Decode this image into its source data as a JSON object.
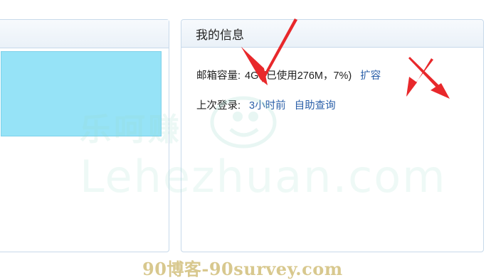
{
  "info_panel": {
    "title": "我的信息",
    "mailbox_label": "邮箱容量:",
    "mailbox_value": "4G",
    "mailbox_usage": "(已使用276M，7%)",
    "expand_link": "扩容",
    "last_login_label": "上次登录:",
    "last_login_value": "3小时前",
    "self_query_link": "自助查询"
  },
  "watermark": {
    "site_cn": "乐呵赚",
    "site_en": "Lehezhuan.com",
    "footer": "90博客-90survey.com"
  },
  "colors": {
    "panel_border": "#c7d9ea",
    "header_bg": "#eaf1f8",
    "cyan_block": "#96e3f7",
    "link": "#2a5fa8",
    "arrow": "#e8282b"
  }
}
